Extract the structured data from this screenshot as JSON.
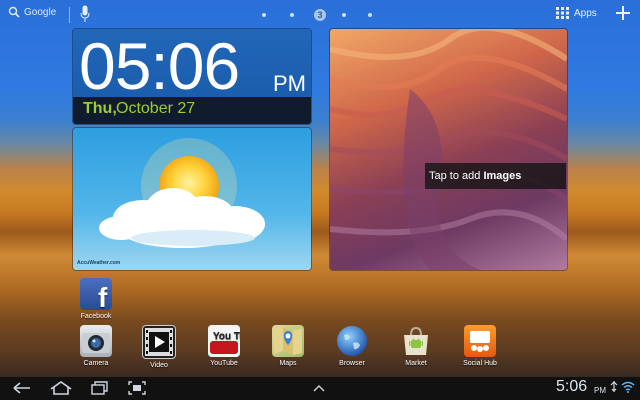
{
  "topbar": {
    "search_label": "Google",
    "page_indicator_current": "3",
    "apps_label": "Apps"
  },
  "clock_widget": {
    "time": "05:06",
    "ampm": "PM",
    "day": "Thu,",
    "date": "October 27"
  },
  "weather_widget": {
    "brand": "AccuWeather.com"
  },
  "photo_widget": {
    "hint_prefix": "Tap to add ",
    "hint_bold": "Images"
  },
  "apps": [
    {
      "label": "Facebook"
    },
    {
      "label": "Camera"
    },
    {
      "label": "Video"
    },
    {
      "label": "YouTube"
    },
    {
      "label": "Maps"
    },
    {
      "label": "Browser"
    },
    {
      "label": "Market"
    },
    {
      "label": "Social Hub"
    }
  ],
  "youtube_icon_text": "You Tube",
  "statusbar": {
    "time": "5:06",
    "ampm": "PM"
  }
}
